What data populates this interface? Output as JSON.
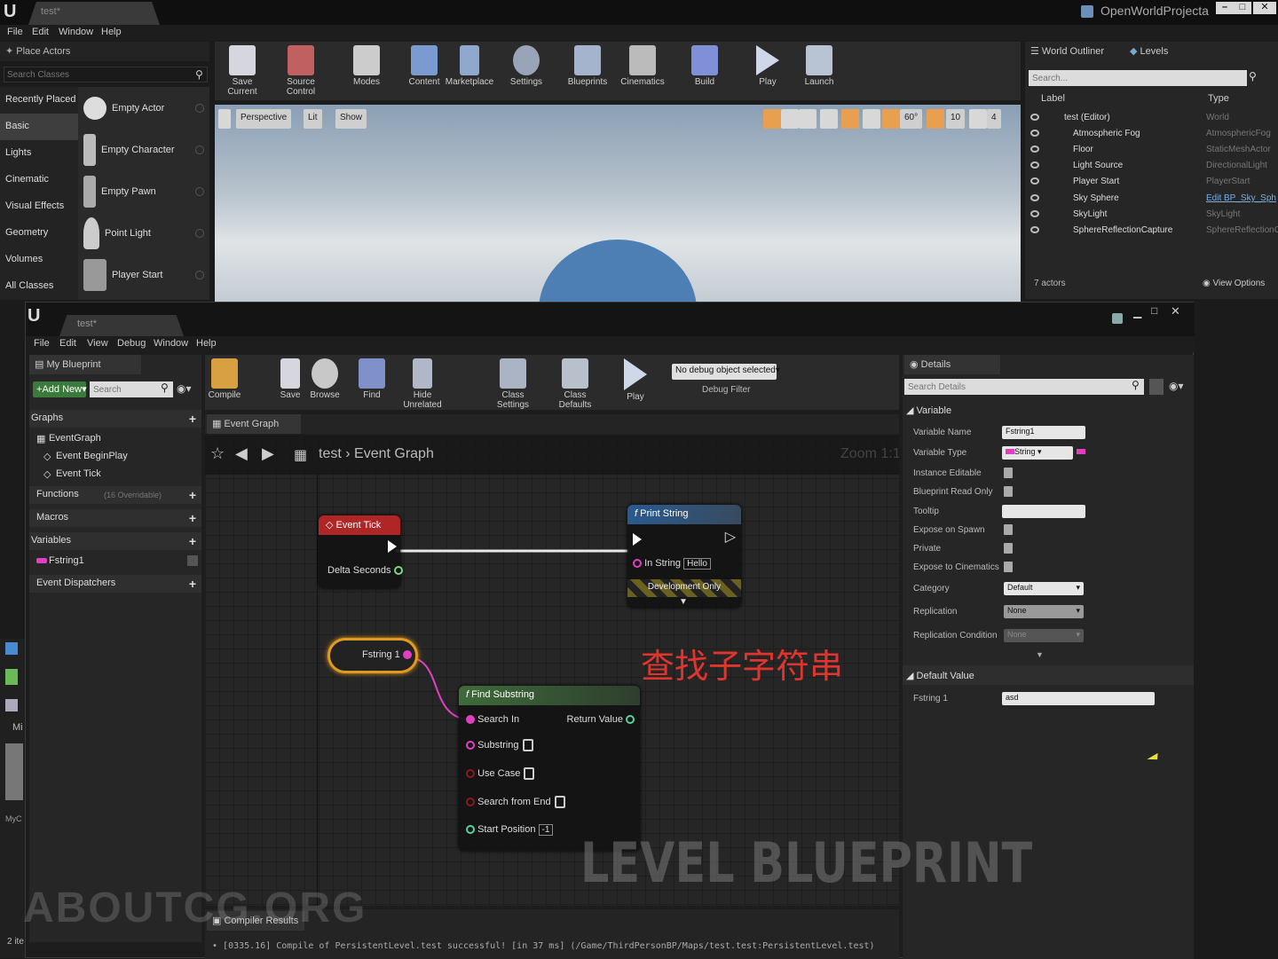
{
  "editor": {
    "tab_title": "test*",
    "project_name": "OpenWorldProjecta",
    "menu": [
      "File",
      "Edit",
      "Window",
      "Help"
    ],
    "place_actors": {
      "header": "Place Actors",
      "search_placeholder": "Search Classes",
      "categories": [
        "Recently Placed",
        "Basic",
        "Lights",
        "Cinematic",
        "Visual Effects",
        "Geometry",
        "Volumes",
        "All Classes"
      ],
      "selected_category": "Basic",
      "items": [
        "Empty Actor",
        "Empty Character",
        "Empty Pawn",
        "Point Light",
        "Player Start"
      ]
    },
    "toolbar": [
      "Save Current",
      "Source Control",
      "Modes",
      "Content",
      "Marketplace",
      "Settings",
      "Blueprints",
      "Cinematics",
      "Build",
      "Play",
      "Launch"
    ],
    "viewport": {
      "perspective": "Perspective",
      "lit": "Lit",
      "show": "Show",
      "fov": "60°",
      "snap": "10",
      "speed": "4"
    },
    "outliner": {
      "tab_outliner": "World Outliner",
      "tab_levels": "Levels",
      "search_placeholder": "Search...",
      "col_label": "Label",
      "col_type": "Type",
      "rows": [
        {
          "label": "test (Editor)",
          "type": "World"
        },
        {
          "label": "Atmospheric Fog",
          "type": "AtmosphericFog"
        },
        {
          "label": "Floor",
          "type": "StaticMeshActor"
        },
        {
          "label": "Light Source",
          "type": "DirectionalLight"
        },
        {
          "label": "Player Start",
          "type": "PlayerStart"
        },
        {
          "label": "Sky Sphere",
          "type": "Edit BP_Sky_Sph"
        },
        {
          "label": "SkyLight",
          "type": "SkyLight"
        },
        {
          "label": "SphereReflectionCapture",
          "type": "SphereReflectionC"
        }
      ],
      "actor_count": "7 actors",
      "view_options": "View Options"
    }
  },
  "blueprint": {
    "tab_title": "test*",
    "menu": [
      "File",
      "Edit",
      "View",
      "Debug",
      "Window",
      "Help"
    ],
    "my_blueprint": {
      "header": "My Blueprint",
      "add_new": "Add New",
      "search_placeholder": "Search",
      "graphs": "Graphs",
      "event_graph": "EventGraph",
      "events": [
        "Event BeginPlay",
        "Event Tick"
      ],
      "functions": "Functions",
      "functions_note": "(16 Overridable)",
      "macros": "Macros",
      "variables": "Variables",
      "variable_items": [
        "Fstring1"
      ],
      "event_dispatchers": "Event Dispatchers"
    },
    "toolbar": [
      "Compile",
      "Save",
      "Browse",
      "Find",
      "Hide Unrelated",
      "Class Settings",
      "Class Defaults",
      "Play"
    ],
    "debug_filter": {
      "value": "No debug object selected",
      "label": "Debug Filter"
    },
    "graph_tab": "Event Graph",
    "breadcrumb": [
      "test",
      "Event Graph"
    ],
    "zoom": "Zoom 1:1",
    "watermark_level": "LEVEL BLUEPRINT",
    "annotation": "查找子字符串",
    "nodes": {
      "event_tick": {
        "title": "Event Tick",
        "pin": "Delta Seconds"
      },
      "print_string": {
        "title": "Print String",
        "pin_in": "In String",
        "pin_value": "Hello",
        "dev": "Development Only"
      },
      "var": {
        "title": "Fstring 1"
      },
      "find_substring": {
        "title": "Find Substring",
        "pins": [
          "Search In",
          "Substring",
          "Use Case",
          "Search from End",
          "Start Position"
        ],
        "start_value": "-1",
        "return": "Return Value"
      }
    },
    "compiler": {
      "tab": "Compiler Results",
      "message": "[0335.16] Compile of PersistentLevel.test successful! [in 37 ms] (/Game/ThirdPersonBP/Maps/test.test:PersistentLevel.test)"
    },
    "details": {
      "header": "Details",
      "search_placeholder": "Search Details",
      "section_variable": "Variable",
      "rows": [
        {
          "label": "Variable Name",
          "value": "Fstring1"
        },
        {
          "label": "Variable Type",
          "value": "String"
        },
        {
          "label": "Instance Editable"
        },
        {
          "label": "Blueprint Read Only"
        },
        {
          "label": "Tooltip",
          "value": ""
        },
        {
          "label": "Expose on Spawn"
        },
        {
          "label": "Private"
        },
        {
          "label": "Expose to Cinematics"
        },
        {
          "label": "Category",
          "value": "Default"
        },
        {
          "label": "Replication",
          "value": "None"
        },
        {
          "label": "Replication Condition",
          "value": "None"
        }
      ],
      "section_default": "Default Value",
      "default_label": "Fstring 1",
      "default_value": "asd"
    }
  },
  "bottom_watermark": "ABOUTCG.ORG",
  "left_partial": [
    "Mi",
    "MyC",
    "2 ite"
  ]
}
